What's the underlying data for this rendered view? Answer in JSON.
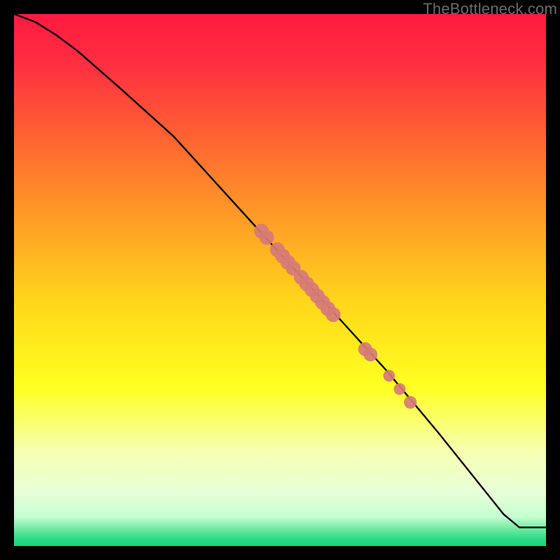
{
  "watermark": "TheBottleneck.com",
  "gradient_stops": [
    {
      "offset": 0.0,
      "color": "#ff1a3f"
    },
    {
      "offset": 0.1,
      "color": "#ff3040"
    },
    {
      "offset": 0.25,
      "color": "#ff6a30"
    },
    {
      "offset": 0.4,
      "color": "#ffa225"
    },
    {
      "offset": 0.55,
      "color": "#ffd91a"
    },
    {
      "offset": 0.7,
      "color": "#ffff20"
    },
    {
      "offset": 0.82,
      "color": "#f6ffb0"
    },
    {
      "offset": 0.9,
      "color": "#e8ffd8"
    },
    {
      "offset": 0.945,
      "color": "#c4ffd0"
    },
    {
      "offset": 0.97,
      "color": "#69e89e"
    },
    {
      "offset": 0.985,
      "color": "#2fdc88"
    },
    {
      "offset": 1.0,
      "color": "#17d67e"
    }
  ],
  "chart_data": {
    "type": "line",
    "title": "",
    "xlabel": "",
    "ylabel": "",
    "xlim": [
      0,
      100
    ],
    "ylim": [
      0,
      100
    ],
    "series": [
      {
        "name": "curve",
        "x": [
          0,
          4,
          8,
          12,
          16,
          20,
          30,
          40,
          50,
          60,
          70,
          80,
          88,
          92,
          95,
          100
        ],
        "y": [
          100,
          98.5,
          96,
          93,
          89.5,
          86,
          77,
          66,
          55,
          44,
          33,
          21,
          11,
          6,
          3.5,
          3.5
        ]
      }
    ],
    "scatter": [
      {
        "x": 46.5,
        "y": 59.2,
        "r": 1.4
      },
      {
        "x": 47.5,
        "y": 58.0,
        "r": 1.4
      },
      {
        "x": 49.5,
        "y": 55.7,
        "r": 1.4
      },
      {
        "x": 50.5,
        "y": 54.5,
        "r": 1.4
      },
      {
        "x": 51.5,
        "y": 53.3,
        "r": 1.4
      },
      {
        "x": 52.5,
        "y": 52.2,
        "r": 1.4
      },
      {
        "x": 54.0,
        "y": 50.5,
        "r": 1.4
      },
      {
        "x": 55.0,
        "y": 49.3,
        "r": 1.4
      },
      {
        "x": 56.0,
        "y": 48.2,
        "r": 1.4
      },
      {
        "x": 57.0,
        "y": 47.0,
        "r": 1.4
      },
      {
        "x": 58.0,
        "y": 45.8,
        "r": 1.4
      },
      {
        "x": 59.0,
        "y": 44.6,
        "r": 1.4
      },
      {
        "x": 60.0,
        "y": 43.5,
        "r": 1.4
      },
      {
        "x": 66.0,
        "y": 37.0,
        "r": 1.3
      },
      {
        "x": 67.0,
        "y": 36.0,
        "r": 1.3
      },
      {
        "x": 70.5,
        "y": 32.0,
        "r": 1.1
      },
      {
        "x": 72.5,
        "y": 29.5,
        "r": 1.1
      },
      {
        "x": 74.5,
        "y": 27.0,
        "r": 1.2
      }
    ],
    "scatter_color": "#d77b77"
  }
}
